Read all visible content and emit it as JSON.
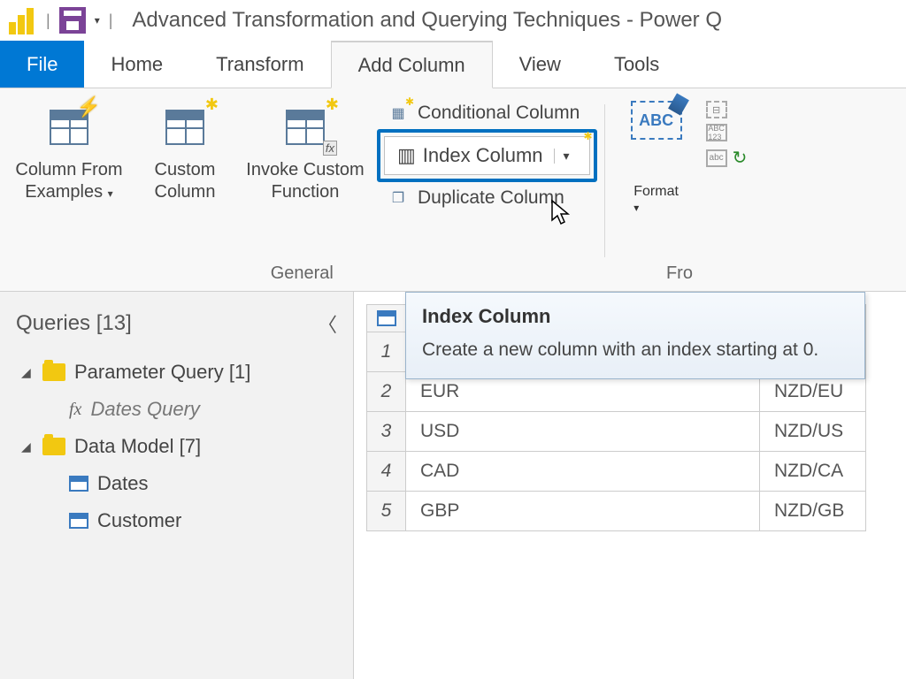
{
  "title": "Advanced Transformation and Querying Techniques - Power Q",
  "tabs": {
    "file": "File",
    "home": "Home",
    "transform": "Transform",
    "add_column": "Add Column",
    "view": "View",
    "tools": "Tools"
  },
  "ribbon": {
    "general_label": "General",
    "from_label": "Fro",
    "col_from_examples": "Column From Examples",
    "custom_column": "Custom Column",
    "invoke_custom_fn": "Invoke Custom Function",
    "conditional_column": "Conditional Column",
    "index_column": "Index Column",
    "duplicate_column": "Duplicate Column",
    "format": "Format",
    "abc_label": "ABC",
    "abc123_label": "ABC\n123",
    "abc_arrow_label": "abc"
  },
  "tooltip": {
    "title": "Index Column",
    "body": "Create a new column with an index starting at 0."
  },
  "queries": {
    "header": "Queries [13]",
    "param_group": "Parameter Query [1]",
    "dates_query": "Dates Query",
    "data_model_group": "Data Model [7]",
    "dates": "Dates",
    "customer": "Customer"
  },
  "grid": {
    "rows": [
      {
        "n": "1",
        "c1": "",
        "c2": ""
      },
      {
        "n": "2",
        "c1": "EUR",
        "c2": "NZD/EU"
      },
      {
        "n": "3",
        "c1": "USD",
        "c2": "NZD/US"
      },
      {
        "n": "4",
        "c1": "CAD",
        "c2": "NZD/CA"
      },
      {
        "n": "5",
        "c1": "GBP",
        "c2": "NZD/GB"
      }
    ]
  }
}
